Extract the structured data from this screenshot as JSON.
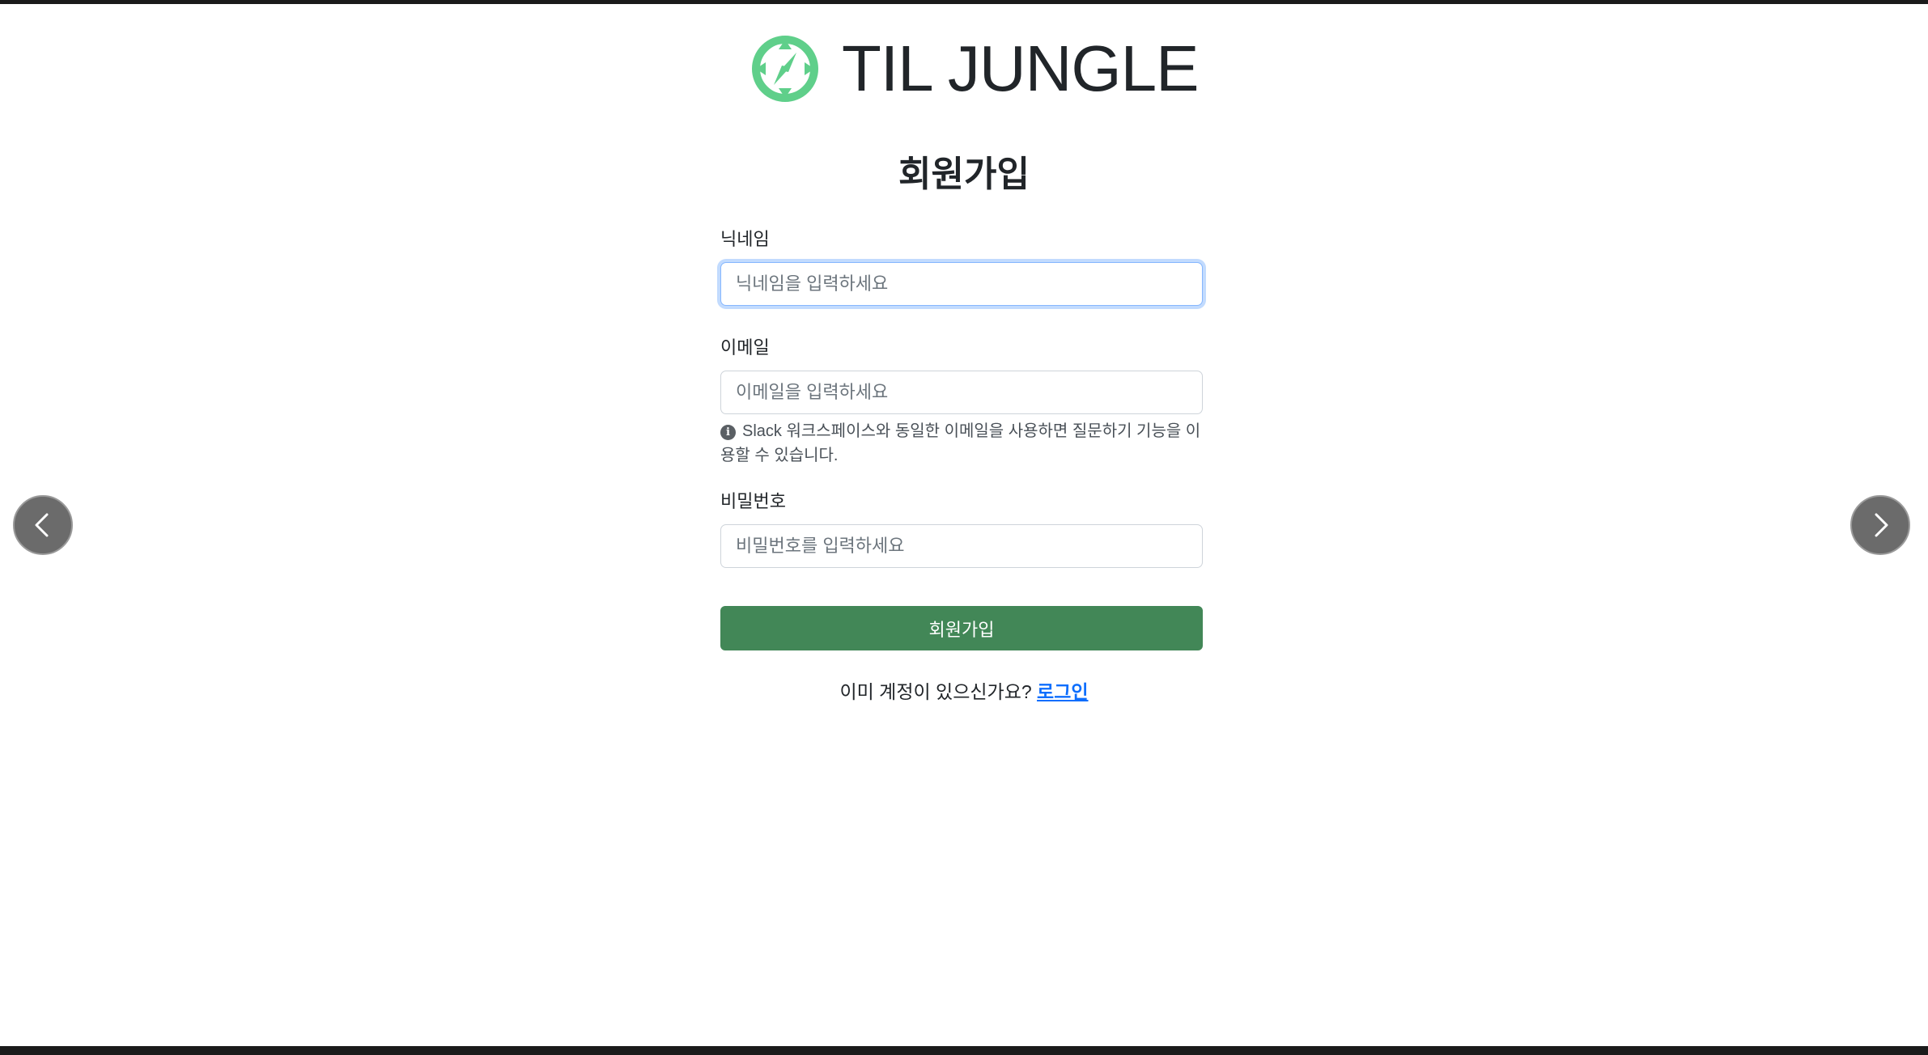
{
  "brand": {
    "name": "TIL JUNGLE",
    "logo_icon": "compass-icon",
    "accent_color": "#5fcf8a"
  },
  "page": {
    "title": "회원가입"
  },
  "form": {
    "nickname": {
      "label": "닉네임",
      "placeholder": "닉네임을 입력하세요",
      "value": ""
    },
    "email": {
      "label": "이메일",
      "placeholder": "이메일을 입력하세요",
      "value": "",
      "help_icon": "info-icon",
      "help_text": "Slack 워크스페이스와 동일한 이메일을 사용하면 질문하기 기능을 이용할 수 있습니다."
    },
    "password": {
      "label": "비밀번호",
      "placeholder": "비밀번호를 입력하세요",
      "value": ""
    },
    "submit_label": "회원가입",
    "submit_color": "#428757"
  },
  "footer": {
    "prompt": "이미 계정이 있으신가요?",
    "login_link": "로그인"
  },
  "navigation": {
    "prev_icon": "chevron-left-icon",
    "next_icon": "chevron-right-icon"
  }
}
